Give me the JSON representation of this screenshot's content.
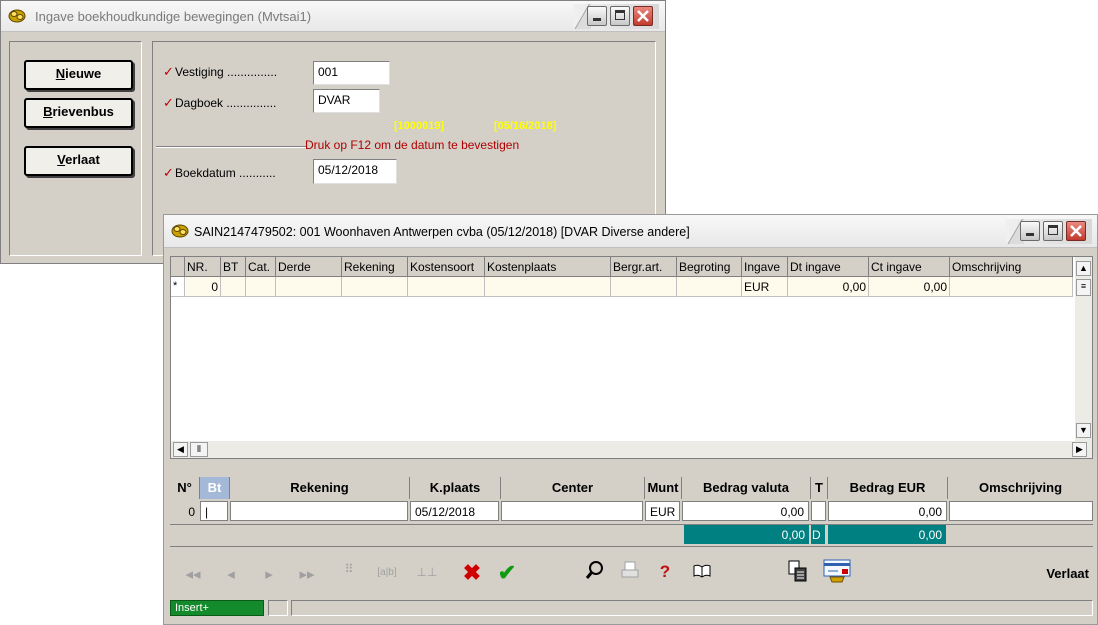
{
  "main_window": {
    "title": "Ingave boekhoudkundige bewegingen (Mvtsai1)",
    "buttons": {
      "nieuwe_accel": "N",
      "nieuwe_rest": "ieuwe",
      "brievenbus_accel": "B",
      "brievenbus_rest": "rievenbus",
      "verlaat_accel": "V",
      "verlaat_rest": "erlaat"
    },
    "fields": {
      "vestiging_label": "Vestiging ...............",
      "vestiging_value": "001",
      "dagboek_label": "Dagboek ...............",
      "dagboek_value": "DVAR",
      "boekdatum_label": "Boekdatum ...........",
      "boekdatum_value": "05/12/2018",
      "check_mark": "✓"
    },
    "yellow_code": "[1000019]",
    "yellow_date": "[05/16/2018]",
    "message": "Druk op F12 om de datum te bevestigen"
  },
  "child_window": {
    "title": "SAIN2147479502: 001 Woonhaven Antwerpen cvba (05/12/2018) [DVAR Diverse andere]",
    "grid": {
      "columns": [
        "NR.",
        "BT",
        "Cat.",
        "Derde",
        "Rekening",
        "Kostensoort",
        "Kostenplaats",
        "Bergr.art.",
        "Begroting",
        "Ingave",
        "Dt ingave",
        "Ct ingave",
        "Omschrijving"
      ],
      "row": {
        "marker": "*",
        "nr": "0",
        "ingave": "EUR",
        "dt_ingave": "0,00",
        "ct_ingave": "0,00"
      }
    },
    "entry": {
      "headers": [
        "N°",
        "Bt",
        "Rekening",
        "K.plaats",
        "Center",
        "Munt",
        "Bedrag valuta",
        "T",
        "Bedrag EUR",
        "Omschrijving"
      ],
      "nr": "0",
      "kplaats": "05/12/2018",
      "munt": "EUR",
      "bedrag_valuta": "0,00",
      "bedrag_eur": "0,00",
      "total_valuta": "0,00",
      "total_t": "D",
      "total_eur": "0,00"
    },
    "toolbar": {
      "verlaat_label": "Verlaat",
      "icons": [
        "first-icon",
        "prev-icon",
        "next-icon",
        "last-icon",
        "insert-row-icon",
        "edit-icon",
        "delete-row-icon",
        "cancel-icon",
        "confirm-icon",
        "search-icon",
        "print-icon",
        "help-icon",
        "book-icon",
        "copy-paste-icon",
        "payment-card-icon"
      ]
    },
    "status": {
      "mode": "Insert+"
    }
  },
  "colors": {
    "accent_teal": "#008080",
    "message_red": "#b00000",
    "highlight_yellow": "#ffff00",
    "insert_green": "#138a2c"
  }
}
